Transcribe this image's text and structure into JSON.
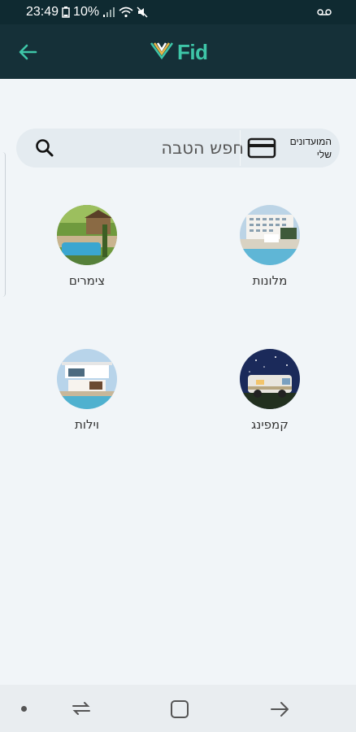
{
  "status_bar": {
    "time": "23:49",
    "battery": "10%"
  },
  "app_bar": {
    "logo_text": "Fid"
  },
  "search": {
    "placeholder": "חפש הטבה",
    "clubs_label": "המועדונים שלי"
  },
  "categories": [
    {
      "label": "מלונות",
      "icon": "hotel-photo"
    },
    {
      "label": "צימרים",
      "icon": "zimmer-photo"
    },
    {
      "label": "קמפינג",
      "icon": "camping-photo"
    },
    {
      "label": "וילות",
      "icon": "villa-photo"
    }
  ],
  "colors": {
    "app_bar": "#153038",
    "status_bar": "#0f2a31",
    "accent": "#3ec6a8",
    "background": "#f1f5f8",
    "search_bg": "#e4ebf0"
  }
}
